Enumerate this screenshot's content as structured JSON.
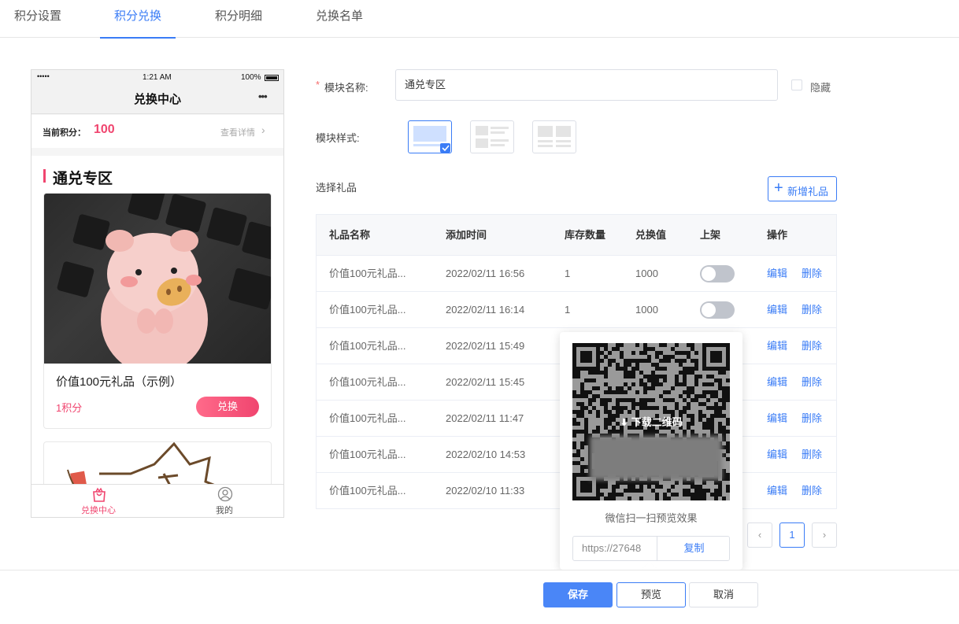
{
  "tabs": [
    {
      "label": "积分设置",
      "active": false
    },
    {
      "label": "积分兑换",
      "active": true
    },
    {
      "label": "积分明细",
      "active": false
    },
    {
      "label": "兑换名单",
      "active": false
    }
  ],
  "phone": {
    "signal": "•••••",
    "time": "1:21 AM",
    "battery": "100%",
    "title": "兑换中心",
    "more": "•••",
    "points_label": "当前积分：",
    "points_value": "100",
    "details_link": "查看详情",
    "section_title": "通兑专区",
    "card": {
      "name": "价值100元礼品（示例）",
      "points": "1积分",
      "exchange_button": "兑换"
    },
    "bottom_nav": [
      {
        "label": "兑换中心",
        "icon": "gift-bag-icon",
        "active": true
      },
      {
        "label": "我的",
        "icon": "user-icon",
        "active": false
      }
    ]
  },
  "form": {
    "required_mark": "*",
    "module_name_label": "模块名称:",
    "module_name_value": "通兑专区",
    "hide_label": "隐藏",
    "module_style_label": "模块样式:",
    "select_gifts_label": "选择礼品",
    "add_gift_button": "新增礼品"
  },
  "table": {
    "headers": [
      "礼品名称",
      "添加时间",
      "库存数量",
      "兑换值",
      "上架",
      "操作"
    ],
    "rows": [
      {
        "name": "价值100元礼品...",
        "time": "2022/02/11 16:56",
        "stock": "1",
        "value": "1000"
      },
      {
        "name": "价值100元礼品...",
        "time": "2022/02/11 16:14",
        "stock": "1",
        "value": "1000"
      },
      {
        "name": "价值100元礼品...",
        "time": "2022/02/11 15:49",
        "stock": "",
        "value": ""
      },
      {
        "name": "价值100元礼品...",
        "time": "2022/02/11 15:45",
        "stock": "",
        "value": ""
      },
      {
        "name": "价值100元礼品...",
        "time": "2022/02/11 11:47",
        "stock": "",
        "value": ""
      },
      {
        "name": "价值100元礼品...",
        "time": "2022/02/10 14:53",
        "stock": "",
        "value": ""
      },
      {
        "name": "价值100元礼品...",
        "time": "2022/02/10 11:33",
        "stock": "",
        "value": ""
      }
    ],
    "edit_label": "编辑",
    "delete_label": "删除"
  },
  "pagination": {
    "current": "1",
    "prev": "‹",
    "next": "›"
  },
  "popover": {
    "download_label": "下载二维码",
    "hint": "微信扫一扫预览效果",
    "url": "https://27648",
    "copy_button": "复制"
  },
  "footer": {
    "save": "保存",
    "preview": "预览",
    "cancel": "取消"
  },
  "colors": {
    "accent": "#3a7cf6",
    "pink": "#f0456f"
  }
}
